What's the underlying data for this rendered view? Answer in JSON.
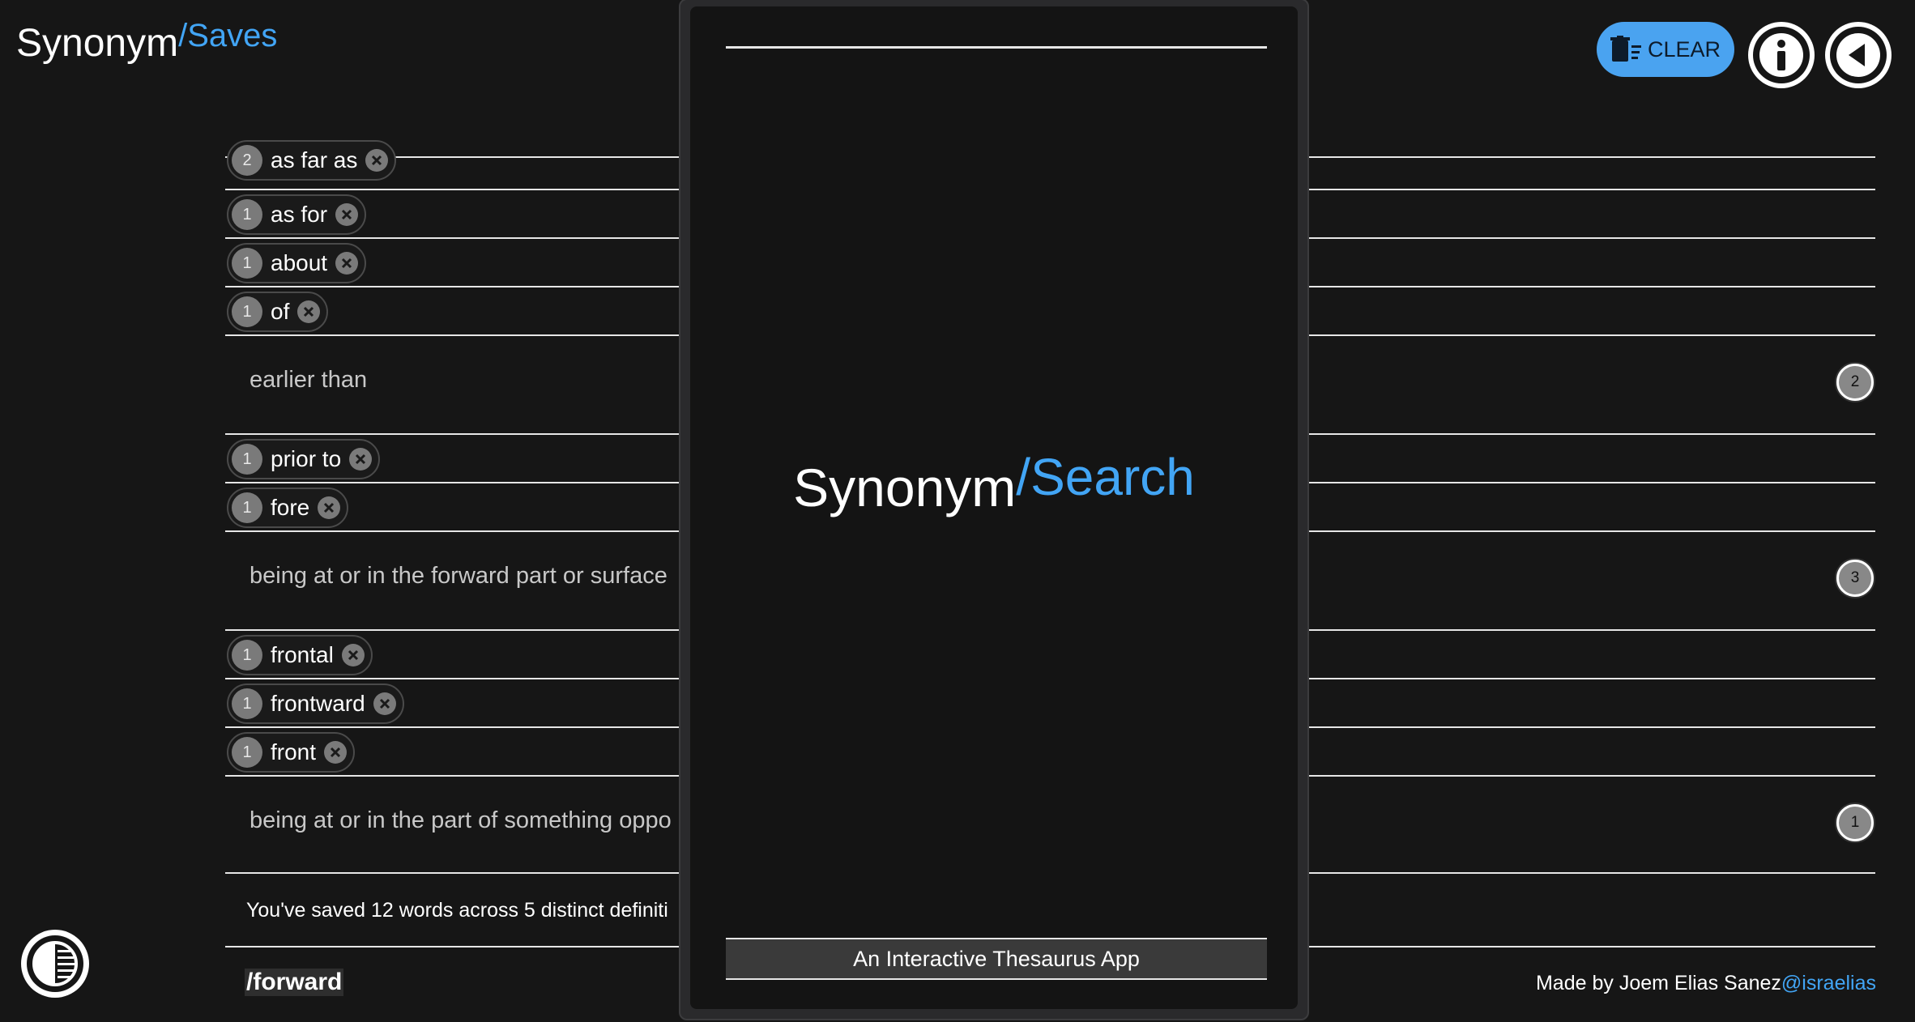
{
  "brand": {
    "main": "Synonym",
    "sub": "/Saves"
  },
  "toolbar": {
    "clear_label": "CLEAR"
  },
  "entries": [
    {
      "kind": "chip",
      "count": "2",
      "word": "as far as"
    },
    {
      "kind": "chip",
      "count": "1",
      "word": "as for"
    },
    {
      "kind": "chip",
      "count": "1",
      "word": "about"
    },
    {
      "kind": "chip",
      "count": "1",
      "word": "of"
    },
    {
      "kind": "definition",
      "text": "earlier than",
      "count": "2"
    },
    {
      "kind": "chip",
      "count": "1",
      "word": "prior to"
    },
    {
      "kind": "chip",
      "count": "1",
      "word": "fore"
    },
    {
      "kind": "definition",
      "text": "being at or in the forward part or surface",
      "count": "3"
    },
    {
      "kind": "chip",
      "count": "1",
      "word": "frontal"
    },
    {
      "kind": "chip",
      "count": "1",
      "word": "frontward"
    },
    {
      "kind": "chip",
      "count": "1",
      "word": "front"
    },
    {
      "kind": "definition",
      "text": "being at or in the part of something oppo",
      "count": "1"
    }
  ],
  "summary": "You've saved 12 words across 5 distinct definiti",
  "current_query": "/forward",
  "footer": {
    "credit": "Made by Joem Elias Sanez",
    "handle": "@israelias"
  },
  "popup": {
    "logo_main": "Synonym",
    "logo_sub": "/Search",
    "tagline": "An Interactive Thesaurus App"
  },
  "colors": {
    "accent": "#42a5f5",
    "background": "#161616",
    "chip_border": "#4a4a4a"
  }
}
